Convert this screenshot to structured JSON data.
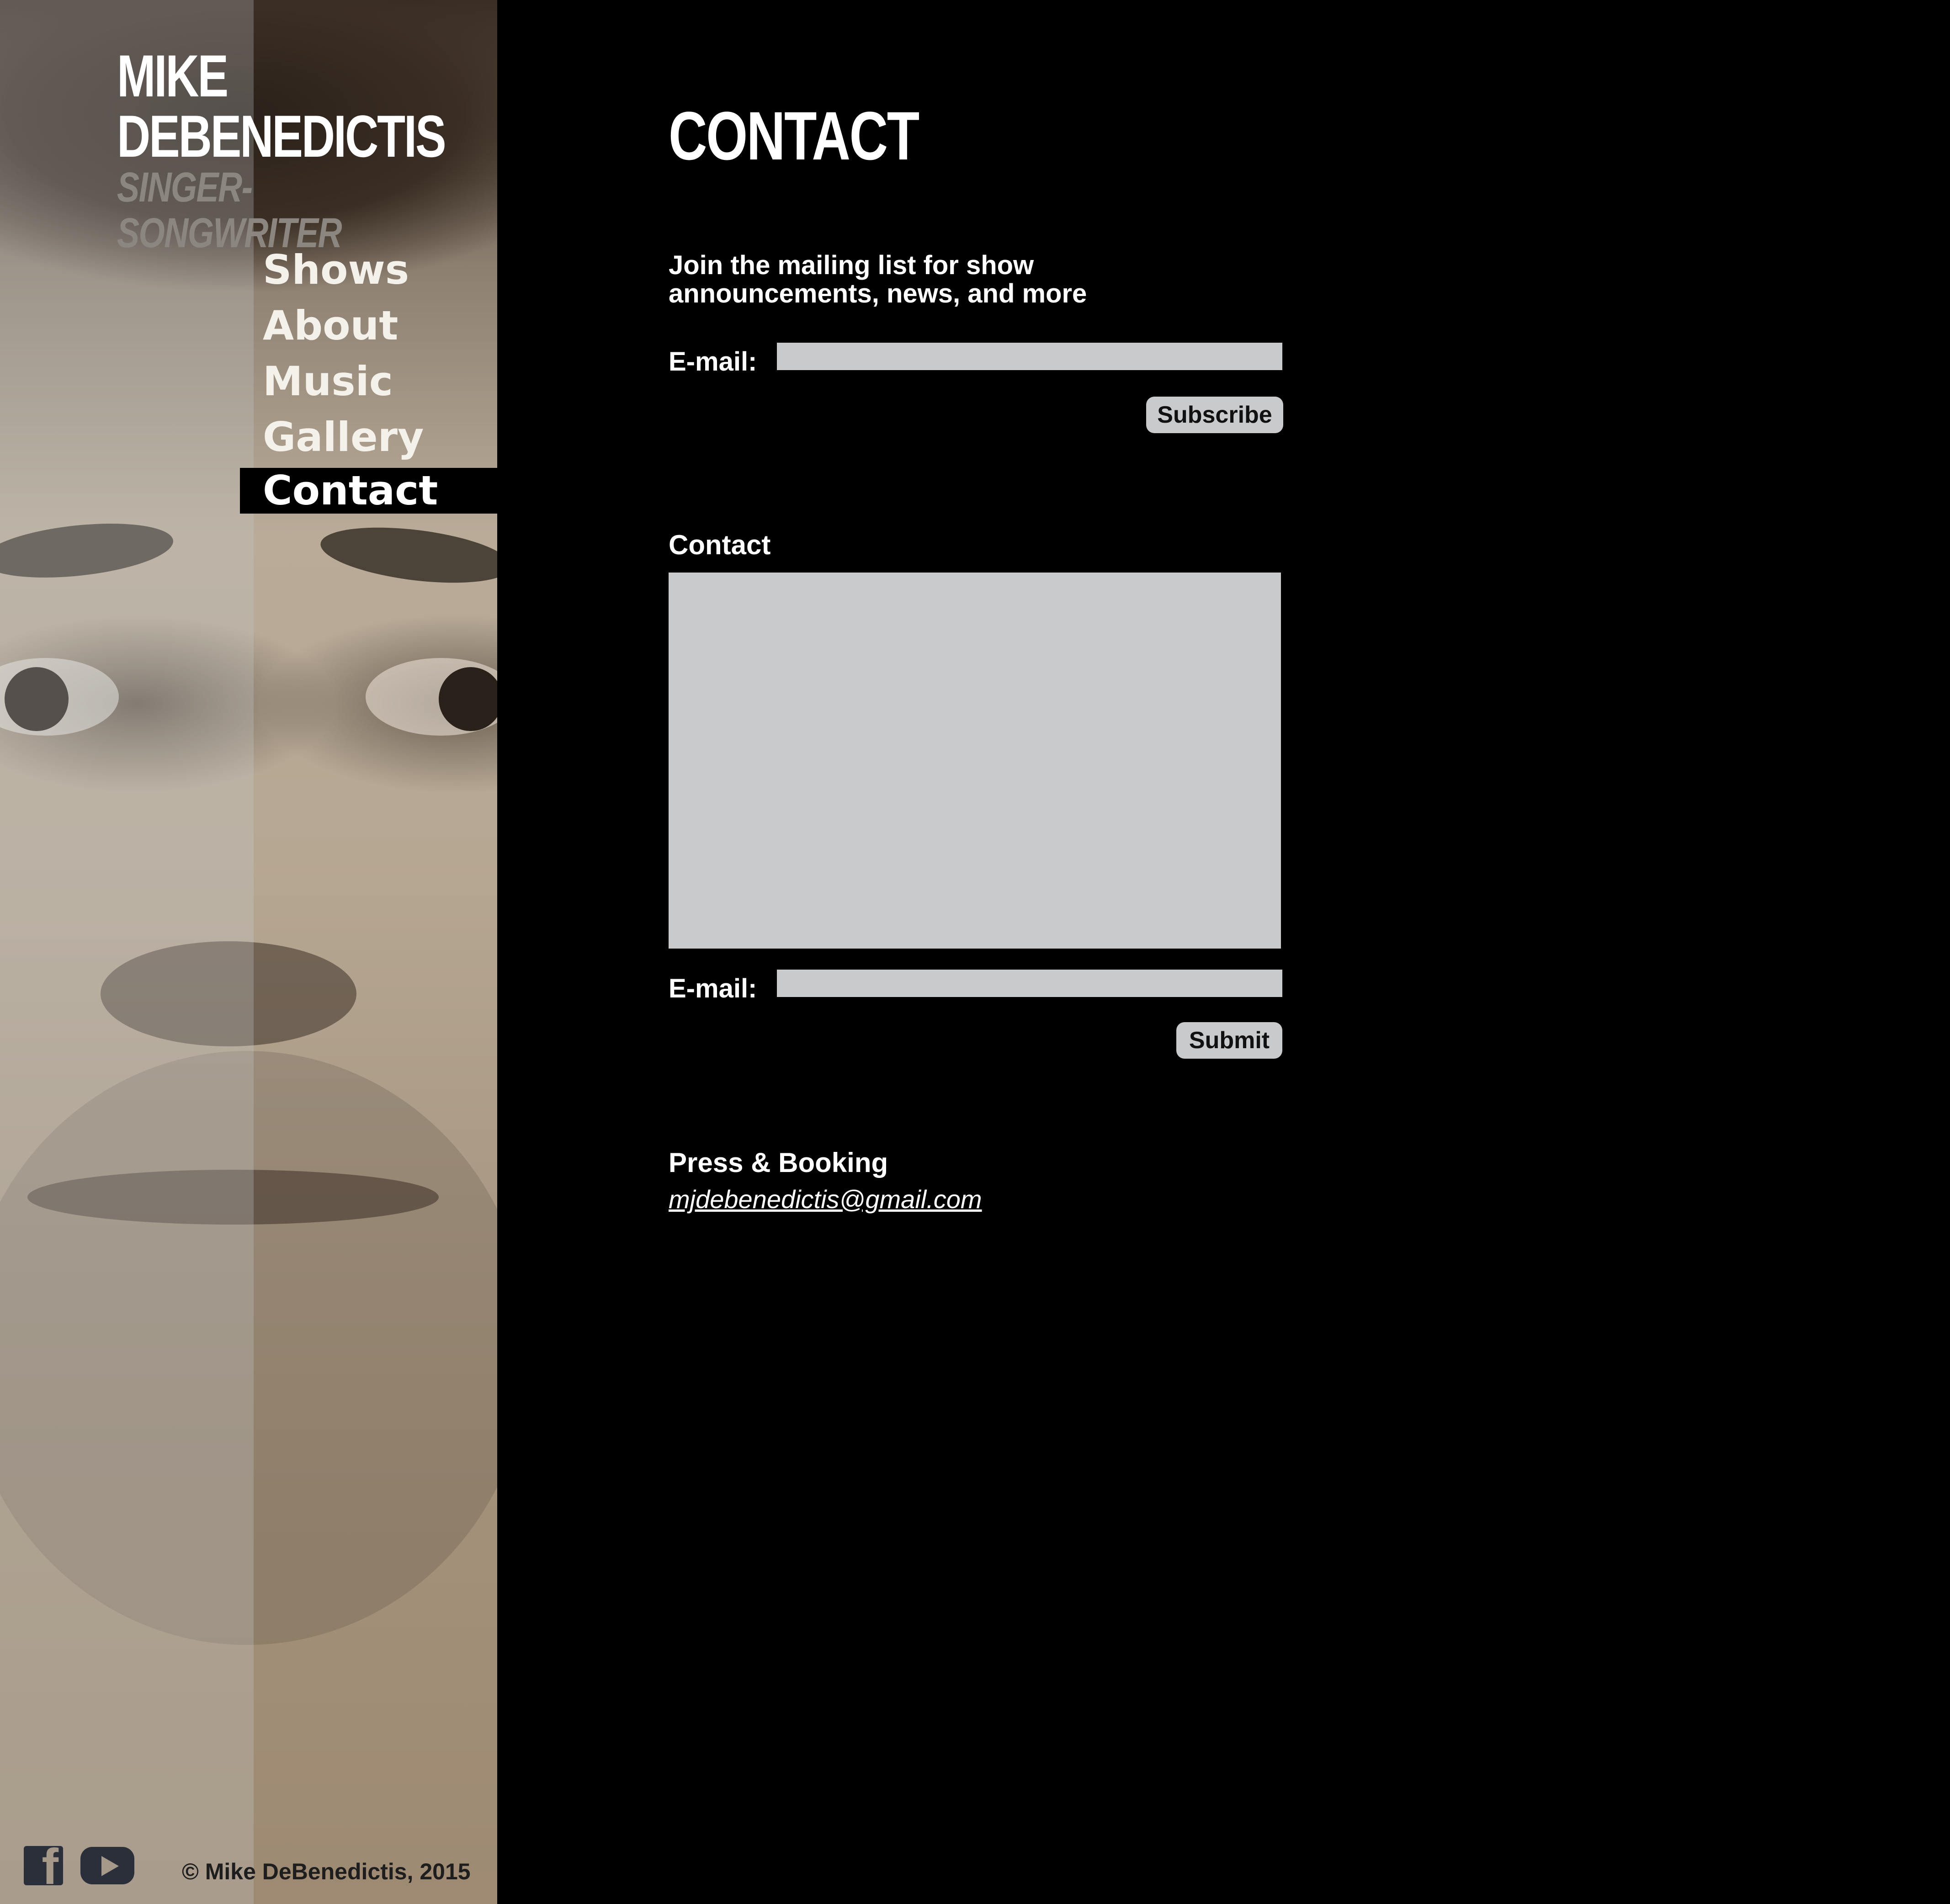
{
  "brand": {
    "name_line1": "MIKE",
    "name_line2": "DEBENEDICTIS",
    "tagline": "SINGER-SONGWRITER"
  },
  "nav": {
    "items": [
      {
        "label": "Shows",
        "active": false
      },
      {
        "label": "About",
        "active": false
      },
      {
        "label": "Music",
        "active": false
      },
      {
        "label": "Gallery",
        "active": false
      },
      {
        "label": "Contact",
        "active": true
      }
    ]
  },
  "footer": {
    "social": [
      {
        "icon": "facebook-icon"
      },
      {
        "icon": "youtube-icon"
      }
    ],
    "copyright": "© Mike DeBenedictis, 2015"
  },
  "main": {
    "title": "CONTACT",
    "mailing": {
      "intro": "Join the mailing list for show announcements, news, and more",
      "email_label": "E-mail:",
      "email_value": "",
      "subscribe_label": "Subscribe"
    },
    "contact": {
      "heading": "Contact",
      "message_value": "",
      "email_label": "E-mail:",
      "email_value": "",
      "submit_label": "Submit"
    },
    "press": {
      "heading": "Press & Booking",
      "email": "mjdebenedictis@gmail.com"
    }
  },
  "colors": {
    "background": "#000000",
    "field": "#c9cacc",
    "tagline": "#8b8680"
  }
}
